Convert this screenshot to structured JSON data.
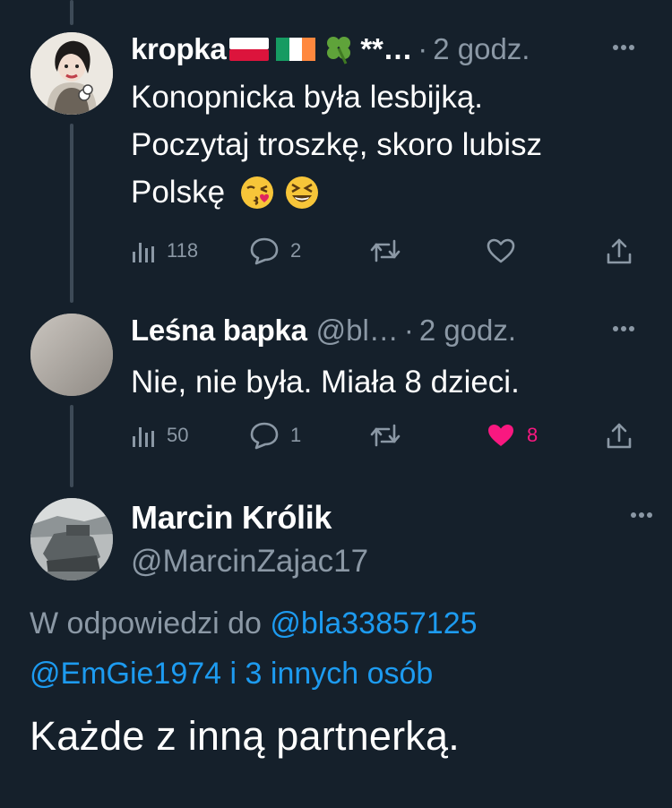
{
  "tweets": [
    {
      "name": "kropka",
      "flags": [
        "poland-flag-icon",
        "ireland-flag-icon",
        "four-leaf-clover-icon"
      ],
      "handle_truncated": "**…",
      "dot": "·",
      "time": "2 godz.",
      "text_lines": [
        "Konopnicka była lesbijką.",
        "Poczytaj troszkę, skoro lubisz",
        "Polskę"
      ],
      "emojis": [
        "kissing-face-emoji",
        "laughing-face-emoji"
      ],
      "views": "118",
      "replies": "2",
      "retweets": "",
      "likes": "",
      "liked": false
    },
    {
      "name": "Leśna bapka",
      "handle": "@bl…",
      "dot": "·",
      "time": "2 godz.",
      "text": "Nie, nie była. Miała 8 dzieci.",
      "views": "50",
      "replies": "1",
      "retweets": "",
      "likes": "8",
      "liked": true
    }
  ],
  "main_tweet": {
    "name": "Marcin Królik",
    "handle": "@MarcinZajac17",
    "reply_prefix": "W odpowiedzi do",
    "reply_mention_1": "@bla33857125",
    "reply_mention_2": "@EmGie1974",
    "reply_and": "i",
    "reply_others": "3 innych osób",
    "text": "Każde z inną partnerką."
  },
  "colors": {
    "background": "#15202b",
    "secondary_text": "#8b98a5",
    "link": "#1d9bf0",
    "like": "#f91880",
    "thread_line": "#3d4a57"
  }
}
